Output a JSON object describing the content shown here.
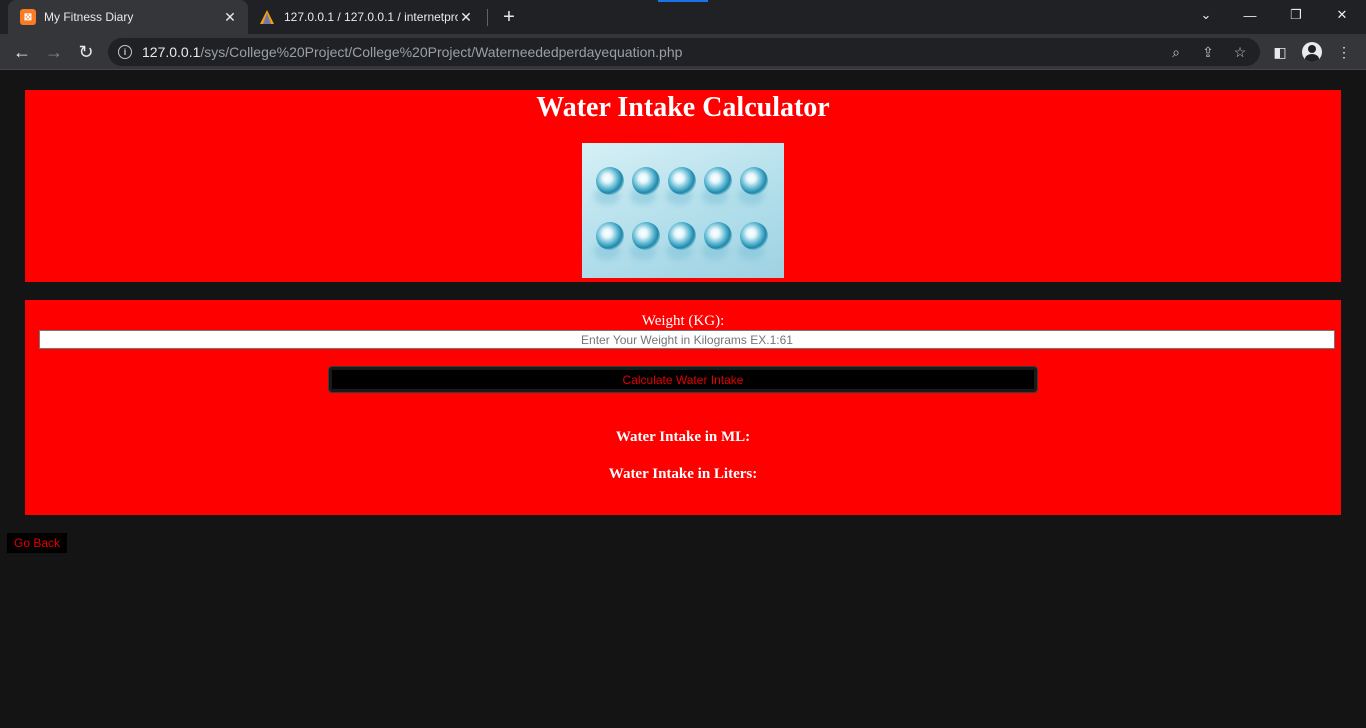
{
  "browser": {
    "tabs": [
      {
        "title": "My Fitness Diary",
        "favicon": "xampp-icon",
        "active": true
      },
      {
        "title": "127.0.0.1 / 127.0.0.1 / internetpro",
        "favicon": "phpmyadmin-icon",
        "active": false
      }
    ],
    "url_host": "127.0.0.1",
    "url_path": "/sys/College%20Project/College%20Project/Waterneededperdayequation.php"
  },
  "page": {
    "title": "Water Intake Calculator",
    "image_alt": "water glasses image",
    "weight_label": "Weight (KG):",
    "weight_value": "",
    "weight_placeholder": "Enter Your Weight in Kilograms EX.1:61",
    "calculate_label": "Calculate Water Intake",
    "result_ml_label": "Water Intake in ML:",
    "result_liters_label": "Water Intake in Liters:",
    "back_label": "Go Back"
  },
  "colors": {
    "panel": "#ff0000",
    "page_bg": "#141414",
    "button_bg": "#000000",
    "button_text": "#e60000"
  }
}
